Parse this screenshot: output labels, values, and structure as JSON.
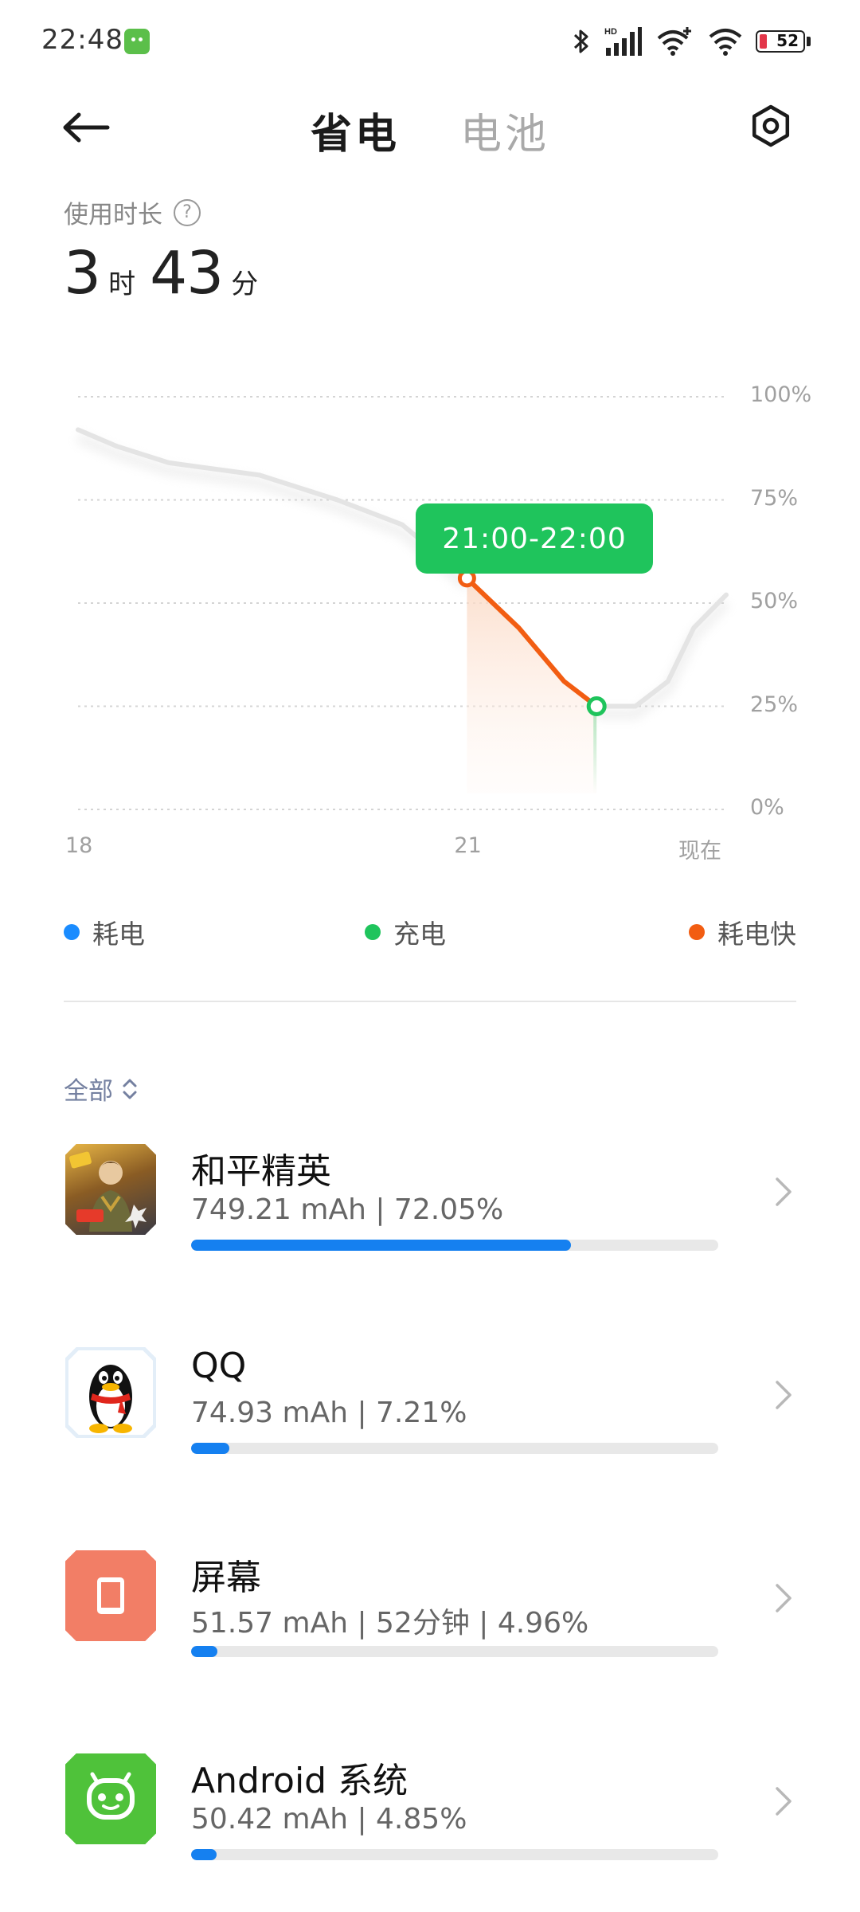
{
  "status_bar": {
    "time": "22:48",
    "app_icon": "android-notification-icon",
    "icons": [
      "bluetooth-icon",
      "hd-signal-icon",
      "wifi-plus-icon",
      "wifi-icon",
      "battery-icon"
    ],
    "battery_level": "52"
  },
  "header": {
    "back_icon": "arrow-left-icon",
    "tabs": [
      {
        "label": "省电",
        "active": true
      },
      {
        "label": "电池",
        "active": false
      }
    ],
    "settings_icon": "settings-icon"
  },
  "usage": {
    "label": "使用时长",
    "hours": "3",
    "hours_unit": "时",
    "minutes": "43",
    "minutes_unit": "分"
  },
  "chart_data": {
    "type": "line",
    "x_ticks": [
      "18",
      "21",
      "现在"
    ],
    "y_ticks": [
      "100%",
      "75%",
      "50%",
      "25%",
      "0%"
    ],
    "ylim": [
      0,
      100
    ],
    "xlim": [
      18,
      23
    ],
    "series": [
      {
        "name": "耗电",
        "x": [
          18,
          18.3,
          18.7,
          19.4,
          20.0,
          20.5,
          21.0
        ],
        "y": [
          92,
          88,
          84,
          81,
          75,
          69,
          56
        ]
      },
      {
        "name": "耗电快",
        "x": [
          21.0,
          21.4,
          21.75,
          22.0
        ],
        "y": [
          56,
          44,
          31,
          25
        ]
      },
      {
        "name": "充电",
        "x": [
          22.0,
          22.3,
          22.55,
          22.75,
          23.0
        ],
        "y": [
          25,
          25,
          31,
          44,
          52
        ]
      }
    ],
    "highlight": {
      "label": "21:00-22:00",
      "from": 21,
      "to": 22
    },
    "grid": true
  },
  "legend": [
    {
      "label": "耗电",
      "color": "#1a8cff"
    },
    {
      "label": "充电",
      "color": "#1fc45c"
    },
    {
      "label": "耗电快",
      "color": "#f25d12"
    }
  ],
  "filter": {
    "label": "全部",
    "icon": "sort-updown-icon"
  },
  "apps": [
    {
      "name": "和平精英",
      "stats": "749.21 mAh | 72.05%",
      "percent": 72.05,
      "icon": "game-icon"
    },
    {
      "name": "QQ",
      "stats": "74.93 mAh | 7.21%",
      "percent": 7.21,
      "icon": "qq-penguin-icon"
    },
    {
      "name": "屏幕",
      "stats": "51.57 mAh | 52分钟 | 4.96%",
      "percent": 4.96,
      "icon": "screen-icon"
    },
    {
      "name": "Android 系统",
      "stats": "50.42 mAh | 4.85%",
      "percent": 4.85,
      "icon": "android-icon"
    }
  ]
}
